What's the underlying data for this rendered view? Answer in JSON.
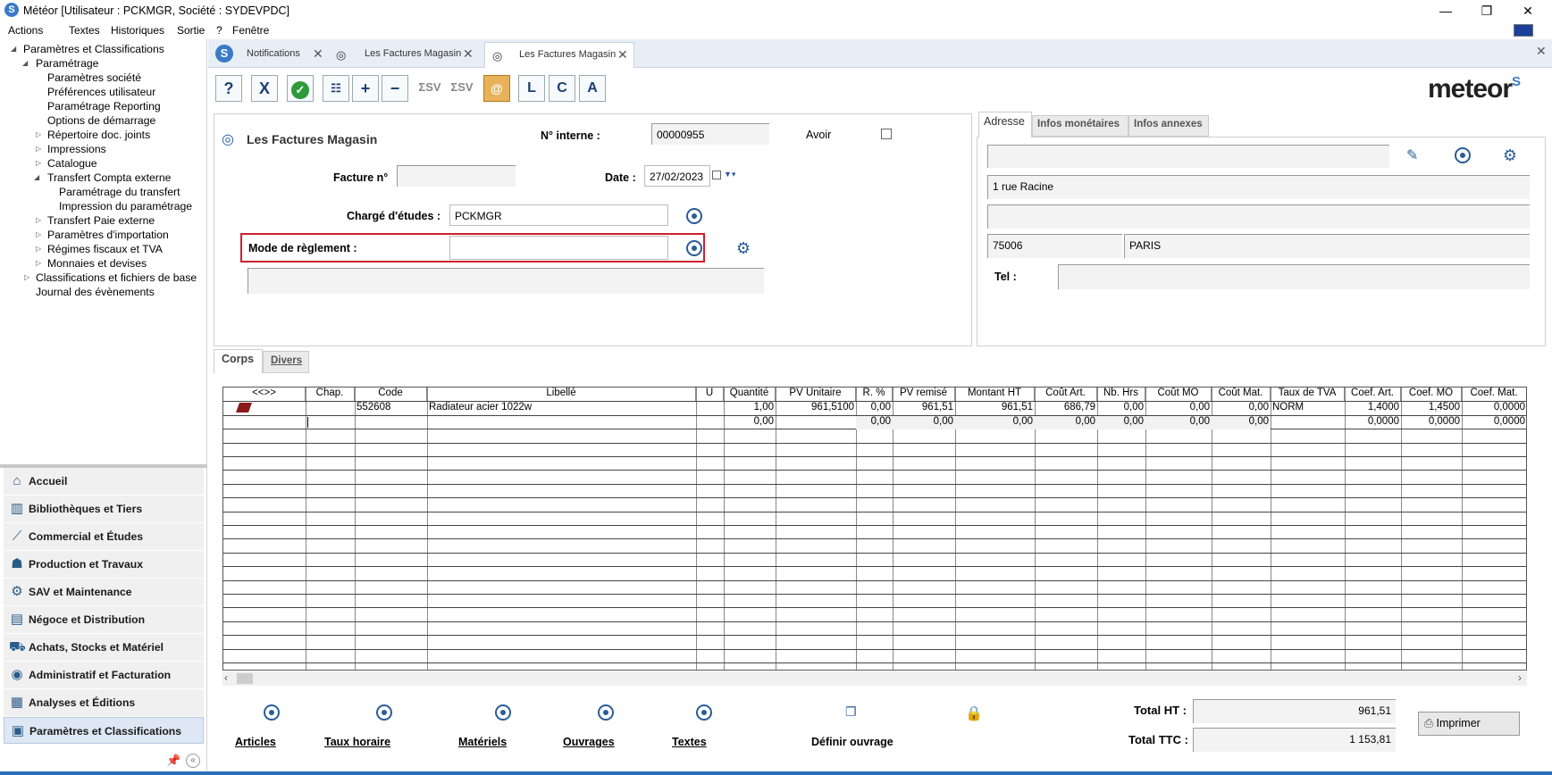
{
  "window": {
    "title": "Météor [Utilisateur : PCKMGR, Société : SYDEVPDC]"
  },
  "menu": [
    "Actions",
    "Textes",
    "Historiques",
    "Sortie",
    "?",
    "Fenêtre"
  ],
  "tree": {
    "root": "Paramètres et Classifications",
    "parametrage": "Paramétrage",
    "items": [
      "Paramètres société",
      "Préférences utilisateur",
      "Paramétrage Reporting",
      "Options de démarrage",
      "Répertoire doc. joints",
      "Impressions",
      "Catalogue",
      "Transfert Compta externe",
      "Paramétrage du transfert",
      "Impression du paramétrage",
      "Transfert Paie externe",
      "Paramètres d'importation",
      "Régimes fiscaux et TVA",
      "Monnaies et devises",
      "Classifications et fichiers de base",
      "Journal des évènements"
    ]
  },
  "nav": [
    "Accueil",
    "Bibliothèques et Tiers",
    "Commercial et Études",
    "Production et Travaux",
    "SAV et Maintenance",
    "Négoce et Distribution",
    "Achats, Stocks et Matériel",
    "Administratif et Facturation",
    "Analyses et Éditions",
    "Paramètres et Classifications"
  ],
  "tabs": [
    "Notifications",
    "Les Factures Magasin",
    "Les Factures Magasin"
  ],
  "toolbar": {
    "help": "?",
    "cancel": "X",
    "ok": "✓",
    "add": "+",
    "remove": "−",
    "sv1": "ΣSV",
    "sv2": "ΣSV",
    "l": "L",
    "c": "C",
    "a": "A"
  },
  "logo": "meteor",
  "form": {
    "title": "Les Factures Magasin",
    "num_interne_label": "N° interne :",
    "num_interne": "00000955",
    "avoir_label": "Avoir",
    "facture_label": "Facture n°",
    "facture": "",
    "date_label": "Date :",
    "date": "27/02/2023",
    "charge_label": "Chargé d'études :",
    "charge": "PCKMGR",
    "mode_label": "Mode de règlement :",
    "mode": ""
  },
  "address_tabs": [
    "Adresse",
    "Infos monétaires",
    "Infos annexes"
  ],
  "address": {
    "line1": "",
    "line2": "1 rue Racine",
    "line3": "",
    "cp": "75006",
    "ville": "PARIS",
    "tel_label": "Tel :",
    "tel": ""
  },
  "body_tabs": [
    "Corps",
    "Divers"
  ],
  "grid": {
    "headers": [
      "<<>>",
      "Chap.",
      "Code",
      "Libellé",
      "U",
      "Quantité",
      "PV Unitaire",
      "R. %",
      "PV remisé",
      "Montant HT",
      "Coût Art.",
      "Nb. Hrs",
      "Coût MO",
      "Coût Mat.",
      "Taux de TVA",
      "Coef. Art.",
      "Coef. MO",
      "Coef. Mat."
    ],
    "rows": [
      [
        "",
        "",
        "552608",
        "Radiateur acier 1022w",
        "",
        "1,00",
        "961,5100",
        "0,00",
        "961,51",
        "961,51",
        "686,79",
        "0,00",
        "0,00",
        "0,00",
        "NORM",
        "1,4000",
        "1,4500",
        "0,0000"
      ],
      [
        "",
        "",
        "",
        "",
        "",
        "0,00",
        "",
        "0,00",
        "0,00",
        "0,00",
        "0,00",
        "0,00",
        "0,00",
        "0,00",
        "",
        "0,0000",
        "0,0000",
        "0,0000"
      ]
    ]
  },
  "bottom": {
    "buttons": [
      "Articles",
      "Taux horaire",
      "Matériels",
      "Ouvrages",
      "Textes",
      "Définir ouvrage"
    ],
    "total_ht_label": "Total HT :",
    "total_ht": "961,51",
    "total_ttc_label": "Total TTC :",
    "total_ttc": "1 153,81",
    "print": "Imprimer"
  },
  "colors": {
    "accent": "#2a5c9a",
    "highlight_border": "#d01f2f"
  }
}
